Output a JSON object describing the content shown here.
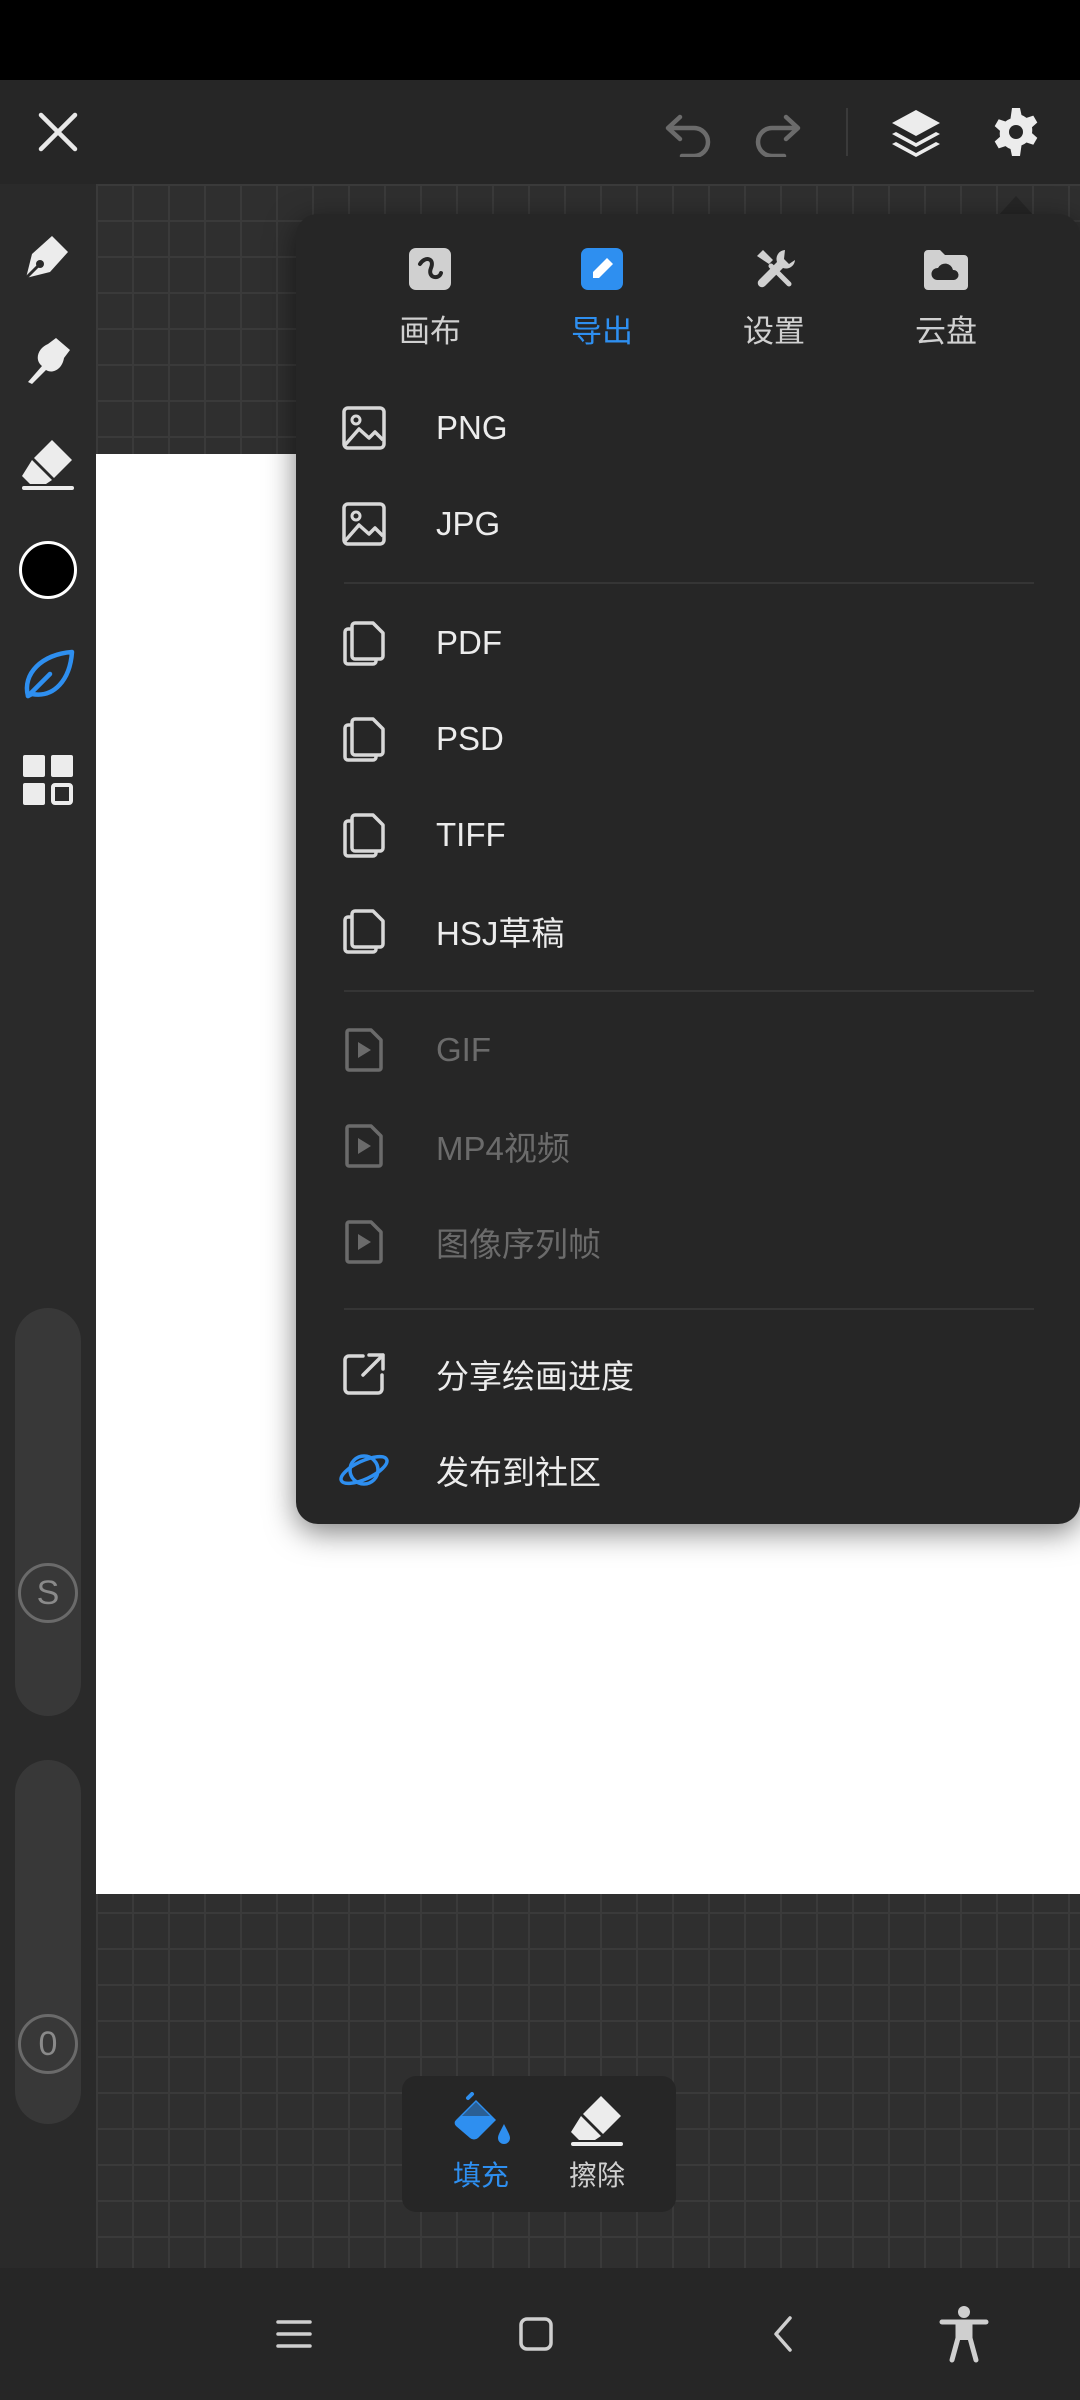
{
  "menu": {
    "tabs": [
      {
        "label": "画布",
        "icon": "canvas-icon",
        "active": false
      },
      {
        "label": "导出",
        "icon": "export-icon",
        "active": true
      },
      {
        "label": "设置",
        "icon": "tools-icon",
        "active": false
      },
      {
        "label": "云盘",
        "icon": "cloud-folder-icon",
        "active": false
      }
    ],
    "items": [
      {
        "label": "PNG",
        "icon": "image-icon",
        "enabled": true
      },
      {
        "label": "JPG",
        "icon": "image-icon",
        "enabled": true
      },
      {
        "label": "PDF",
        "icon": "copy-icon",
        "enabled": true
      },
      {
        "label": "PSD",
        "icon": "copy-icon",
        "enabled": true
      },
      {
        "label": "TIFF",
        "icon": "copy-icon",
        "enabled": true
      },
      {
        "label": "HSJ草稿",
        "icon": "copy-icon",
        "enabled": true
      },
      {
        "label": "GIF",
        "icon": "video-file-icon",
        "enabled": false
      },
      {
        "label": "MP4视频",
        "icon": "video-file-icon",
        "enabled": false
      },
      {
        "label": "图像序列帧",
        "icon": "video-file-icon",
        "enabled": false
      },
      {
        "label": "分享绘画进度",
        "icon": "share-icon",
        "enabled": true
      },
      {
        "label": "发布到社区",
        "icon": "planet-icon",
        "enabled": true
      }
    ]
  },
  "sliders": {
    "size_label": "S",
    "opacity_value": "0"
  },
  "bottom_popup": {
    "fill_label": "填充",
    "erase_label": "擦除"
  },
  "colors": {
    "accent": "#2e8ff0",
    "current_color": "#000000",
    "panel": "#262626",
    "disabled_text": "#6b6b6b"
  }
}
